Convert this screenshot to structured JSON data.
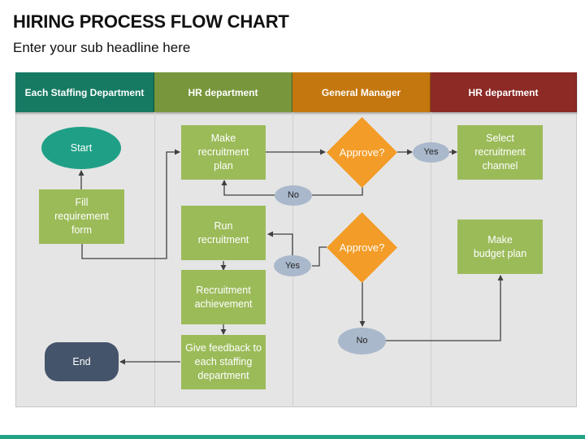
{
  "header": {
    "title": "HIRING PROCESS FLOW CHART",
    "subtitle": "Enter your sub headline here"
  },
  "lanes": [
    {
      "label": "Each Staffing Department",
      "color": "#167a63"
    },
    {
      "label": "HR department",
      "color": "#78963c"
    },
    {
      "label": "General Manager",
      "color": "#c5770f"
    },
    {
      "label": "HR department",
      "color": "#8c2a25"
    }
  ],
  "nodes": {
    "start": "Start",
    "fill_form": "Fill\nrequirement\nform",
    "end": "End",
    "make_plan": "Make\nrecruitment\nplan",
    "run_recruitment": "Run\nrecruitment",
    "achievement": "Recruitment\nachievement",
    "feedback": "Give feedback to\neach staffing\ndepartment",
    "approve_1": "Approve?",
    "approve_2": "Approve?",
    "select_channel": "Select\nrecruitment\nchannel",
    "budget_plan": "Make\nbudget plan"
  },
  "decisions": {
    "yes_1": "Yes",
    "no_1": "No",
    "yes_2": "Yes",
    "no_2": "No"
  },
  "colors": {
    "process": "#9bbb59",
    "start": "#1fa086",
    "end": "#44546a",
    "decision": "#f39c27",
    "outcome": "#a9b8cb",
    "footer": "#21a385"
  }
}
